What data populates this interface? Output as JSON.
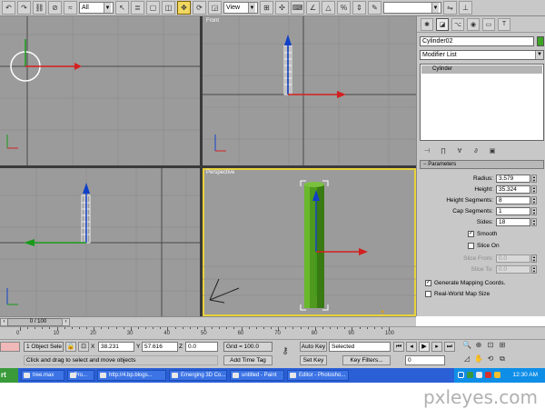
{
  "toolbar": {
    "selection_filter": "All",
    "reference_coord": "View",
    "named_selection": ""
  },
  "viewports": {
    "top_label": "",
    "front_label": "Front",
    "left_label": "",
    "perspective_label": "Perspective",
    "axis_z": "z",
    "axis_x": "x",
    "axis_y": "y"
  },
  "panel": {
    "object_name": "Cylinder02",
    "object_color": "#3da324",
    "modifier_list": "Modifier List",
    "stack_items": [
      "Cylinder"
    ],
    "rollout_title": "Parameters",
    "params": [
      {
        "label": "Radius:",
        "value": "3.579",
        "enabled": true
      },
      {
        "label": "Height:",
        "value": "35.324",
        "enabled": true
      },
      {
        "label": "Height Segments:",
        "value": "8",
        "enabled": true
      },
      {
        "label": "Cap Segments:",
        "value": "1",
        "enabled": true
      },
      {
        "label": "Sides:",
        "value": "18",
        "enabled": true
      }
    ],
    "smooth_label": "Smooth",
    "smooth_checked": true,
    "slice_on_label": "Slice On",
    "slice_on_checked": false,
    "slice_from": {
      "label": "Slice From:",
      "value": "0.0"
    },
    "slice_to": {
      "label": "Slice To:",
      "value": "0.0"
    },
    "gen_mapping_label": "Generate Mapping Coords.",
    "gen_mapping_checked": true,
    "real_world_label": "Real-World Map Size",
    "real_world_checked": false
  },
  "timeline": {
    "frame_display": "0 / 100",
    "ruler_ticks": [
      "0",
      "10",
      "20",
      "30",
      "40",
      "50",
      "60",
      "70",
      "80",
      "90",
      "100"
    ]
  },
  "status": {
    "selection_count": "1 Object Sele",
    "x_value": "38.231",
    "y_value": "57.616",
    "z_value": "0.0",
    "x_label": "X",
    "y_label": "Y",
    "z_label": "Z",
    "grid": "Grid = 100.0",
    "prompt": "Click and drag to select and move objects",
    "add_time_tag": "Add Time Tag",
    "auto_key": "Auto Key",
    "set_key": "Set Key",
    "selected": "Selected",
    "key_filters": "Key Filters...",
    "frame_field": "0"
  },
  "taskbar": {
    "start": "rt",
    "tasks": [
      "tree.max",
      "- Pro...",
      "http://4.bp.blogs...",
      "Emerging 3D Co...",
      "untitled - Paint",
      "Editor - Photosho..."
    ],
    "clock": "12:30 AM"
  },
  "watermark": "pxleyes.com",
  "colors": {
    "viewport_bg": "#9b9b9b",
    "active_border": "#e8d23a",
    "cylinder": "#4f9a1e",
    "taskbar": "#2a5fd6"
  }
}
